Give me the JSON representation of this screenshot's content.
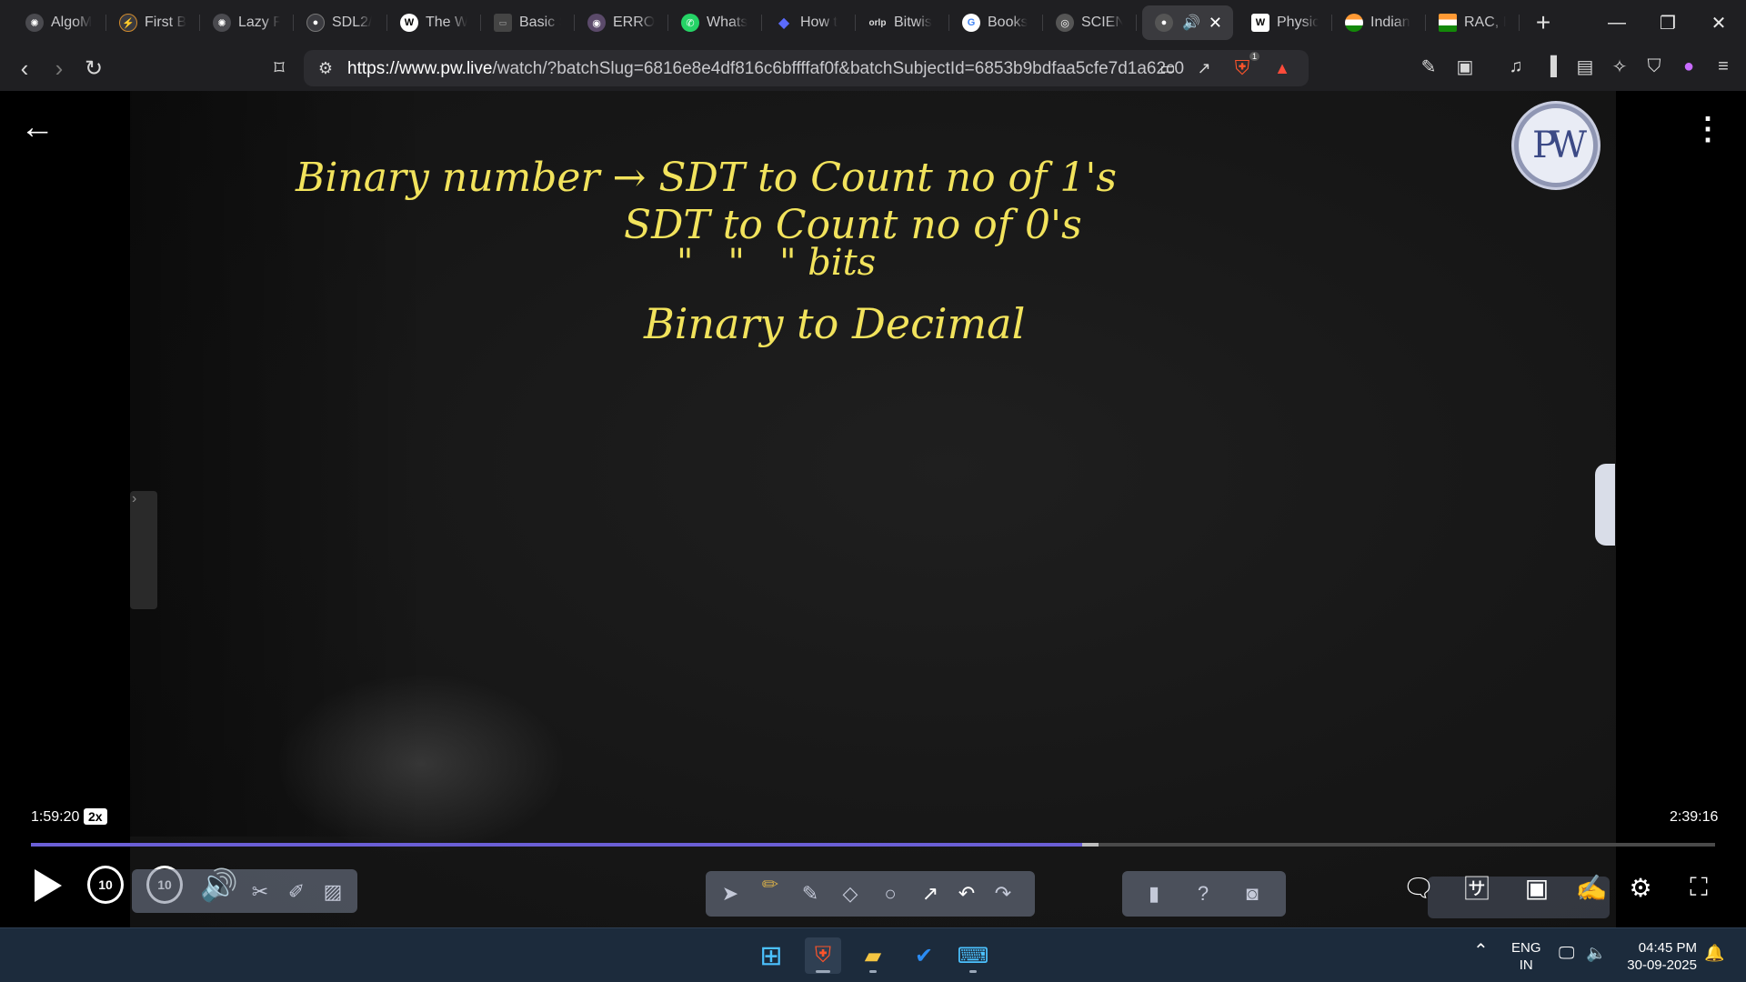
{
  "tabs": [
    {
      "label": "AlgoM",
      "icon": "openai-icon"
    },
    {
      "label": "First B",
      "icon": "ai-icon"
    },
    {
      "label": "Lazy F",
      "icon": "openai-icon"
    },
    {
      "label": "SDL2/",
      "icon": "github-icon"
    },
    {
      "label": "The W",
      "icon": "w-icon"
    },
    {
      "label": "Basic S",
      "icon": "page-icon"
    },
    {
      "label": "ERROI",
      "icon": "globe-icon"
    },
    {
      "label": "Whats",
      "icon": "whatsapp-icon"
    },
    {
      "label": "How t",
      "icon": "bookmark-icon"
    },
    {
      "label": "Bitwis",
      "icon": "orlp-icon"
    },
    {
      "label": "Books",
      "icon": "google-icon"
    },
    {
      "label": "SCIEN",
      "icon": "globe-icon"
    },
    {
      "label": "",
      "icon": "pw-icon",
      "active": true,
      "audio": "🔊",
      "close": "✕"
    },
    {
      "label": "Physic",
      "icon": "w-icon"
    },
    {
      "label": "Indian",
      "icon": "flag-icon"
    },
    {
      "label": "RAC, I",
      "icon": "india-flag-icon"
    }
  ],
  "new_tab_label": "+",
  "window_controls": {
    "minimize": "—",
    "restore": "❐",
    "close": "✕"
  },
  "address": {
    "url_host": "https://www.pw.live",
    "url_rest": "/watch/?batchSlug=6816e8e4df816c6bffffaf0f&batchSubjectId=6853b9bdfaa5cfe7d1a62c0...",
    "brave_badge": "1"
  },
  "video": {
    "notes": [
      "Binary number → SDT to Count no of 1's",
      "SDT to Count no of 0's",
      "\"   \"   \" bits",
      "Binary to Decimal"
    ],
    "logo_text": "PW",
    "time_elapsed": "1:59:20",
    "speed": "2x",
    "time_total": "2:39:16",
    "progress": 0.6241,
    "buffered": 0.6341,
    "skip_back": "10",
    "skip_forward": "10",
    "progress_color": "#6b5fd6"
  },
  "taskbar": {
    "lang_line1": "ENG",
    "lang_line2": "IN",
    "time": "04:45 PM",
    "date": "30-09-2025"
  }
}
